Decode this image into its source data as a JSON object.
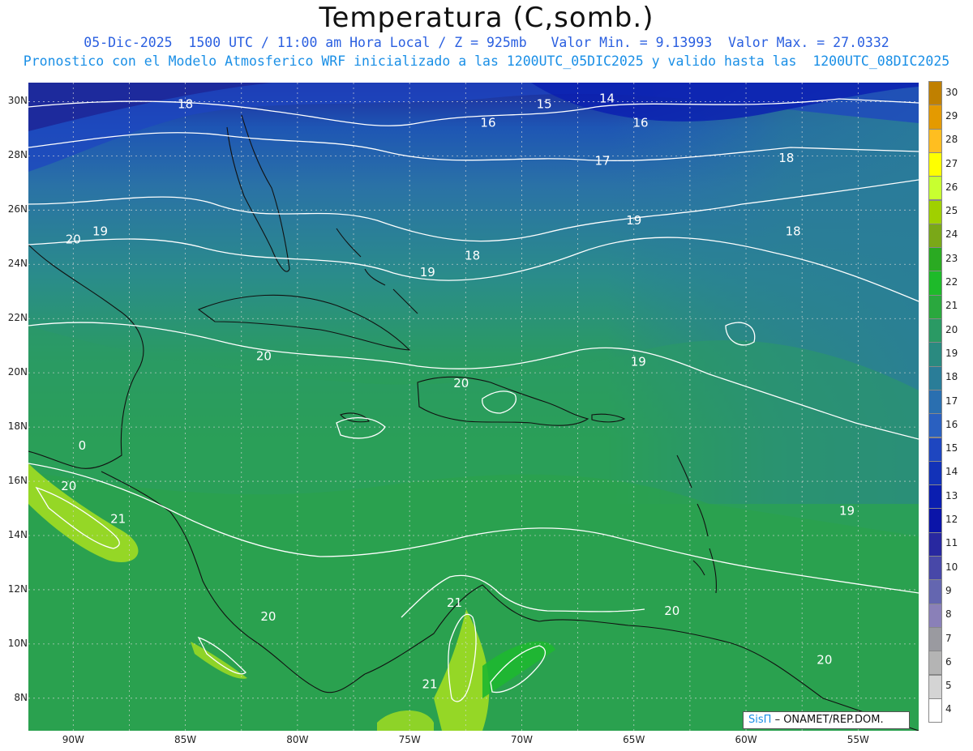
{
  "header": {
    "title": "Temperatura (C,somb.)",
    "line1": "05-Dic-2025  1500 UTC / 11:00 am Hora Local / Z = 925mb   Valor Min. = 9.13993  Valor Max. = 27.0332",
    "line2": "Pronostico con el Modelo Atmosferico WRF inicializado a las 1200UTC_05DIC2025 y valido hasta las  1200UTC_08DIC2025"
  },
  "axes": {
    "lat_ticks": [
      "30N",
      "28N",
      "26N",
      "24N",
      "22N",
      "20N",
      "18N",
      "16N",
      "14N",
      "12N",
      "10N",
      "8N"
    ],
    "lon_ticks": [
      "90W",
      "85W",
      "80W",
      "75W",
      "70W",
      "65W",
      "60W",
      "55W"
    ]
  },
  "contour_labels": [
    {
      "text": "18",
      "lon": -85.0,
      "lat": 29.9
    },
    {
      "text": "16",
      "lon": -71.5,
      "lat": 29.2
    },
    {
      "text": "15",
      "lon": -69.0,
      "lat": 29.9
    },
    {
      "text": "14",
      "lon": -66.2,
      "lat": 30.1
    },
    {
      "text": "16",
      "lon": -64.7,
      "lat": 29.2
    },
    {
      "text": "17",
      "lon": -66.4,
      "lat": 27.8
    },
    {
      "text": "18",
      "lon": -58.2,
      "lat": 27.9
    },
    {
      "text": "19",
      "lon": -65.0,
      "lat": 25.6
    },
    {
      "text": "18",
      "lon": -57.9,
      "lat": 25.2
    },
    {
      "text": "18",
      "lon": -72.2,
      "lat": 24.3
    },
    {
      "text": "19",
      "lon": -74.2,
      "lat": 23.7
    },
    {
      "text": "20",
      "lon": -90.0,
      "lat": 24.9
    },
    {
      "text": "19",
      "lon": -88.8,
      "lat": 25.2
    },
    {
      "text": "20",
      "lon": -81.5,
      "lat": 20.6
    },
    {
      "text": "20",
      "lon": -72.7,
      "lat": 19.6
    },
    {
      "text": "19",
      "lon": -64.8,
      "lat": 20.4
    },
    {
      "text": "20",
      "lon": -90.2,
      "lat": 15.8
    },
    {
      "text": "21",
      "lon": -88.0,
      "lat": 14.6
    },
    {
      "text": "0",
      "lon": -89.6,
      "lat": 17.3
    },
    {
      "text": "19",
      "lon": -55.5,
      "lat": 14.9
    },
    {
      "text": "21",
      "lon": -73.0,
      "lat": 11.5
    },
    {
      "text": "20",
      "lon": -81.3,
      "lat": 11.0
    },
    {
      "text": "20",
      "lon": -63.3,
      "lat": 11.2
    },
    {
      "text": "21",
      "lon": -74.1,
      "lat": 8.5
    },
    {
      "text": "20",
      "lon": -56.5,
      "lat": 9.4
    }
  ],
  "colorbar": {
    "levels": [
      "30",
      "29",
      "28",
      "27",
      "26",
      "25",
      "24",
      "23",
      "22",
      "21",
      "20",
      "19",
      "18",
      "17",
      "16",
      "15",
      "14",
      "13",
      "12",
      "11",
      "10",
      "9",
      "8",
      "7",
      "6",
      "5",
      "4"
    ],
    "colors": [
      "#c08000",
      "#e49a00",
      "#ffbe20",
      "#ffff00",
      "#c8ff30",
      "#a0d000",
      "#7aa818",
      "#2aaa22",
      "#1eba2a",
      "#2aa83e",
      "#2a9a64",
      "#2a8a80",
      "#2a7d98",
      "#2a6fb0",
      "#2a60c0",
      "#1e46c0",
      "#1232b8",
      "#0a1eb0",
      "#0a14a8",
      "#2828a0",
      "#4848a8",
      "#6466b0",
      "#8a80b8",
      "#9a9aa0",
      "#b4b4b4",
      "#d4d4d4",
      "#ffffff"
    ]
  },
  "map_colors": {
    "north_deep": "#1d2a9c",
    "north_blue": "#1e56b4",
    "mid_blue": "#2a72a6",
    "teal": "#2a8c8a",
    "sea_green": "#2a9a64",
    "green": "#2ba44a",
    "bright_green": "#1eb830",
    "lime": "#a8e01e",
    "coast": "#111111",
    "contour": "#ffffff"
  },
  "credit": {
    "brand": "SisΠ",
    "text": "– ONAMET/REP.DOM."
  }
}
